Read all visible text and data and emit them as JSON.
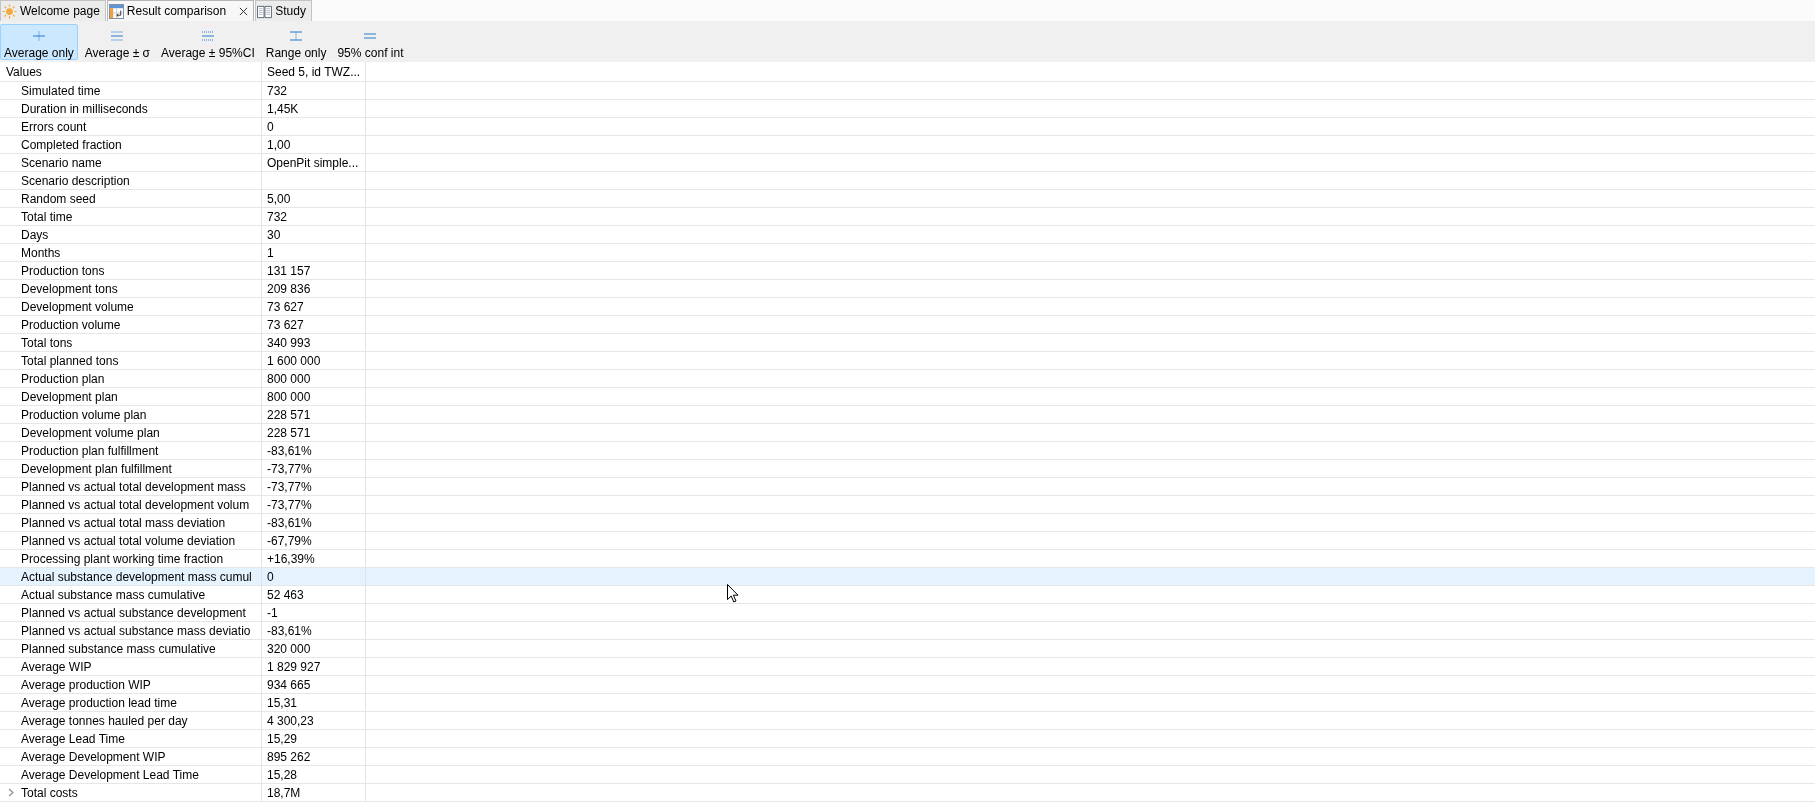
{
  "tabs": [
    {
      "label": "Welcome page",
      "selected": false
    },
    {
      "label": "Result comparison",
      "selected": true
    },
    {
      "label": "Study",
      "selected": false
    }
  ],
  "toolbar": [
    {
      "label": "Average only",
      "selected": true
    },
    {
      "label": "Average ± σ",
      "selected": false
    },
    {
      "label": "Average ± 95%CI",
      "selected": false
    },
    {
      "label": "Range only",
      "selected": false
    },
    {
      "label": "95% conf int",
      "selected": false
    }
  ],
  "table": {
    "columns": [
      "Values",
      "Seed 5, id TWZ..."
    ],
    "rows": [
      {
        "kind": "value",
        "label": "Simulated time",
        "value": "732",
        "selected": false
      },
      {
        "kind": "value",
        "label": "Duration in milliseconds",
        "value": "1,45K",
        "selected": false
      },
      {
        "kind": "value",
        "label": "Errors count",
        "value": "0",
        "selected": false
      },
      {
        "kind": "value",
        "label": "Completed fraction",
        "value": "1,00",
        "selected": false
      },
      {
        "kind": "value",
        "label": "Scenario name",
        "value": "OpenPit simple...",
        "selected": false
      },
      {
        "kind": "value",
        "label": "Scenario description",
        "selected": false
      },
      {
        "kind": "value",
        "label": "Random seed",
        "value": "5,00",
        "selected": false
      },
      {
        "kind": "value",
        "label": "Total time",
        "value": "732",
        "selected": false
      },
      {
        "kind": "value",
        "label": "Days",
        "value": "30",
        "selected": false
      },
      {
        "kind": "value",
        "label": "Months",
        "value": "1",
        "selected": false
      },
      {
        "kind": "value",
        "label": "Production tons",
        "value": "131 157",
        "selected": false
      },
      {
        "kind": "value",
        "label": "Development tons",
        "value": "209 836",
        "selected": false
      },
      {
        "kind": "value",
        "label": "Development volume",
        "value": "73 627",
        "selected": false
      },
      {
        "kind": "value",
        "label": "Production volume",
        "value": "73 627",
        "selected": false
      },
      {
        "kind": "value",
        "label": "Total tons",
        "value": "340 993",
        "selected": false
      },
      {
        "kind": "value",
        "label": "Total planned tons",
        "value": "1 600 000",
        "selected": false
      },
      {
        "kind": "value",
        "label": "Production plan",
        "value": "800 000",
        "selected": false
      },
      {
        "kind": "value",
        "label": "Development plan",
        "value": "800 000",
        "selected": false
      },
      {
        "kind": "value",
        "label": "Production volume plan",
        "value": "228 571",
        "selected": false
      },
      {
        "kind": "value",
        "label": "Development volume plan",
        "value": "228 571",
        "selected": false
      },
      {
        "kind": "value",
        "label": "Production plan fulfillment",
        "value": "-83,61%",
        "selected": false
      },
      {
        "kind": "value",
        "label": "Development plan fulfillment",
        "value": "-73,77%",
        "selected": false
      },
      {
        "kind": "value",
        "label": "Planned vs actual total development mass",
        "value": "-73,77%",
        "selected": false
      },
      {
        "kind": "value",
        "label": "Planned vs actual total development volum",
        "value": "-73,77%",
        "selected": false
      },
      {
        "kind": "value",
        "label": "Planned vs actual total mass deviation",
        "value": "-83,61%",
        "selected": false
      },
      {
        "kind": "value",
        "label": "Planned vs actual total volume deviation",
        "value": "-67,79%",
        "selected": false
      },
      {
        "kind": "value",
        "label": "Processing plant working time fraction",
        "value": "+16,39%",
        "selected": false
      },
      {
        "kind": "value",
        "label": "Actual substance development mass cumul",
        "value": "0",
        "selected": true
      },
      {
        "kind": "value",
        "label": "Actual substance mass cumulative",
        "value": "52 463",
        "selected": false
      },
      {
        "kind": "value",
        "label": "Planned vs actual substance development",
        "value": "-1",
        "selected": false
      },
      {
        "kind": "value",
        "label": "Planned vs actual substance mass deviatio",
        "value": "-83,61%",
        "selected": false
      },
      {
        "kind": "value",
        "label": "Planned substance mass cumulative",
        "value": "320 000",
        "selected": false
      },
      {
        "kind": "value",
        "label": "Average WIP",
        "value": "1 829 927",
        "selected": false
      },
      {
        "kind": "value",
        "label": "Average production WIP",
        "value": "934 665",
        "selected": false
      },
      {
        "kind": "value",
        "label": "Average production lead time",
        "value": "15,31",
        "selected": false
      },
      {
        "kind": "value",
        "label": "Average tonnes hauled per day",
        "value": "4 300,23",
        "selected": false
      },
      {
        "kind": "value",
        "label": "Average Lead Time",
        "value": "15,29",
        "selected": false
      },
      {
        "kind": "value",
        "label": "Average Development WIP",
        "value": "895 262",
        "selected": false
      },
      {
        "kind": "value",
        "label": "Average Development Lead Time",
        "value": "15,28",
        "selected": false
      },
      {
        "kind": "group",
        "label": "Total costs",
        "value": "18,7M",
        "selected": false,
        "expanded": false
      }
    ]
  }
}
